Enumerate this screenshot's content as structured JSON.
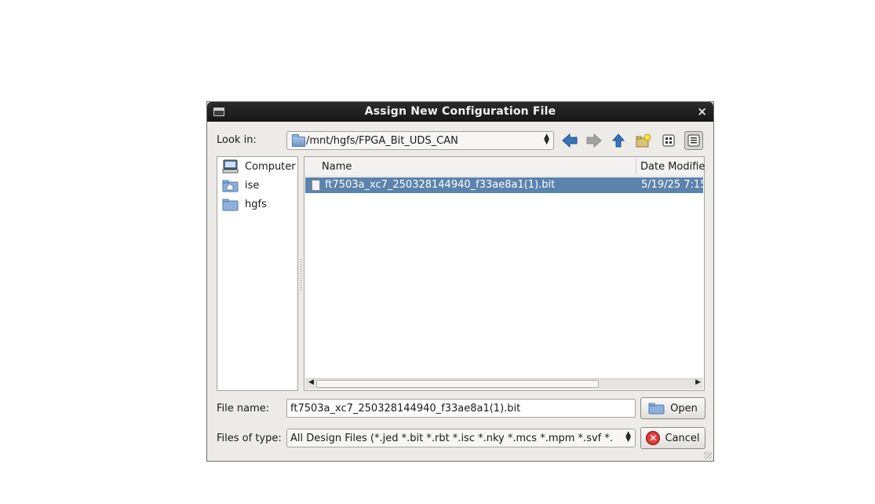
{
  "dialog": {
    "title": "Assign New Configuration File",
    "close_glyph": "×"
  },
  "look_in": {
    "label": "Look in:",
    "path": "/mnt/hgfs/FPGA_Bit_UDS_CAN"
  },
  "toolbar": {
    "icons": [
      "back-arrow-icon",
      "forward-arrow-icon",
      "up-folder-icon",
      "new-folder-icon",
      "list-view-icon",
      "details-view-icon"
    ]
  },
  "places": [
    {
      "label": "Computer",
      "icon": "computer-icon"
    },
    {
      "label": "ise",
      "icon": "home-folder-icon"
    },
    {
      "label": "hgfs",
      "icon": "folder-icon"
    }
  ],
  "file_list": {
    "columns": {
      "name": "Name",
      "date": "Date Modifie"
    },
    "rows": [
      {
        "name": "ft7503a_xc7_250328144940_f33ae8a1(1).bit",
        "date": "5/19/25 7:15",
        "selected": true
      }
    ]
  },
  "file_name": {
    "label": "File name:",
    "value": "ft7503a_xc7_250328144940_f33ae8a1(1).bit"
  },
  "file_type": {
    "label": "Files of type:",
    "value": "All Design Files (*.jed *.bit *.rbt *.isc *.nky *.mcs *.mpm *.svf *."
  },
  "buttons": {
    "open": "Open",
    "cancel": "Cancel"
  },
  "colors": {
    "selection": "#5b83ad",
    "titlebar": "#1f1f1f",
    "dialog_bg": "#edebe8"
  }
}
